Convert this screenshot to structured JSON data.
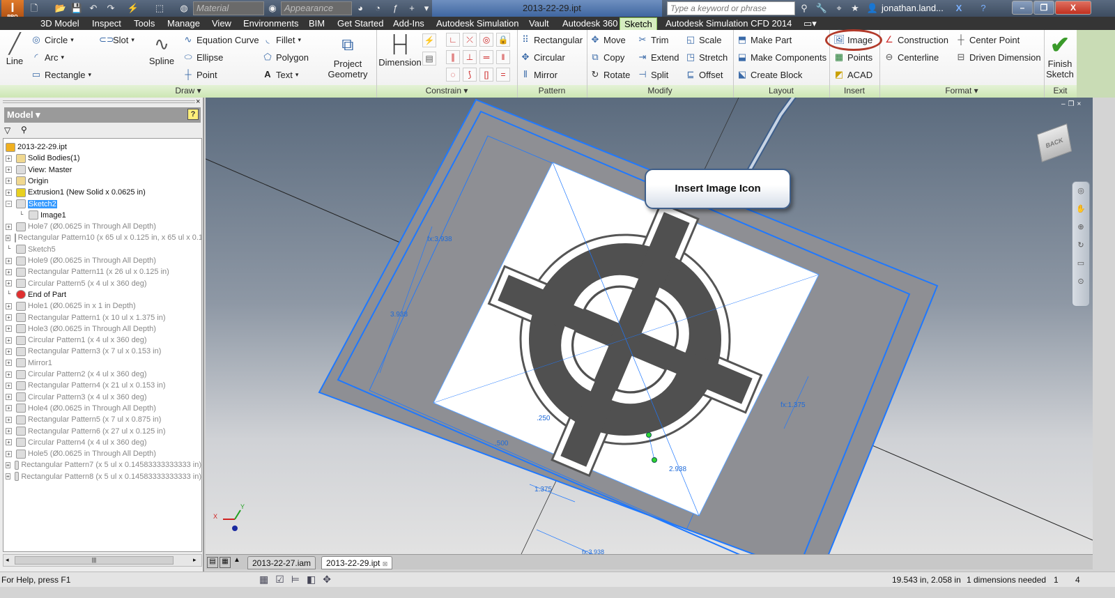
{
  "titlebar": {
    "app_icon_label": "PRO",
    "material": "Material",
    "appearance": "Appearance",
    "document_title": "2013-22-29.ipt",
    "search_placeholder": "Type a keyword or phrase",
    "user": "jonathan.land...",
    "minimize": "–",
    "restore": "❐",
    "close": "X"
  },
  "tabs": [
    "3D Model",
    "Inspect",
    "Tools",
    "Manage",
    "View",
    "Environments",
    "BIM",
    "Get Started",
    "Add-Ins",
    "Autodesk Simulation",
    "Vault",
    "Autodesk 360",
    "Sketch",
    "Autodesk Simulation CFD 2014"
  ],
  "active_tab": "Sketch",
  "ribbon": {
    "draw": {
      "line": "Line",
      "circle": "Circle",
      "arc": "Arc",
      "rectangle": "Rectangle",
      "slot": "Slot",
      "spline": "Spline",
      "equation_curve": "Equation Curve",
      "ellipse": "Ellipse",
      "point": "Point",
      "fillet": "Fillet",
      "polygon": "Polygon",
      "text": "Text",
      "project_geometry_1": "Project",
      "project_geometry_2": "Geometry",
      "label": "Draw ▾"
    },
    "constrain": {
      "dimension": "Dimension",
      "label": "Constrain ▾"
    },
    "pattern": {
      "rectangular": "Rectangular",
      "circular": "Circular",
      "mirror": "Mirror",
      "label": "Pattern"
    },
    "modify": {
      "move": "Move",
      "copy": "Copy",
      "rotate": "Rotate",
      "trim": "Trim",
      "extend": "Extend",
      "split": "Split",
      "scale": "Scale",
      "stretch": "Stretch",
      "offset": "Offset",
      "label": "Modify"
    },
    "layout": {
      "make_part": "Make Part",
      "make_components": "Make Components",
      "create_block": "Create Block",
      "label": "Layout"
    },
    "insert": {
      "image": "Image",
      "points": "Points",
      "acad": "ACAD",
      "label": "Insert"
    },
    "format": {
      "construction": "Construction",
      "centerline": "Centerline",
      "center_point": "Center Point",
      "driven_dimension": "Driven Dimension",
      "label": "Format ▾"
    },
    "exit": {
      "finish_1": "Finish",
      "finish_2": "Sketch",
      "label": "Exit"
    }
  },
  "browser": {
    "title": "Model ▾",
    "help": "?",
    "items": [
      {
        "label": "2013-22-29.ipt",
        "level": 0,
        "state": "normal",
        "expand": ""
      },
      {
        "label": "Solid Bodies(1)",
        "level": 1,
        "state": "normal",
        "expand": "+"
      },
      {
        "label": "View: Master",
        "level": 1,
        "state": "normal",
        "expand": "+"
      },
      {
        "label": "Origin",
        "level": 1,
        "state": "normal",
        "expand": "+"
      },
      {
        "label": "Extrusion1 (New Solid x 0.0625 in)",
        "level": 1,
        "state": "normal",
        "expand": "+"
      },
      {
        "label": "Sketch2",
        "level": 1,
        "state": "selected",
        "expand": "−"
      },
      {
        "label": "Image1",
        "level": 2,
        "state": "normal",
        "expand": ""
      },
      {
        "label": "Hole7 (Ø0.0625 in Through All Depth)",
        "level": 1,
        "state": "grey",
        "expand": "+"
      },
      {
        "label": "Rectangular Pattern10 (x 65 ul x 0.125 in, x 65 ul x 0.1",
        "level": 1,
        "state": "grey",
        "expand": "+"
      },
      {
        "label": "Sketch5",
        "level": 1,
        "state": "grey",
        "expand": ""
      },
      {
        "label": "Hole9 (Ø0.0625 in Through All Depth)",
        "level": 1,
        "state": "grey",
        "expand": "+"
      },
      {
        "label": "Rectangular Pattern11 (x 26 ul x 0.125 in)",
        "level": 1,
        "state": "grey",
        "expand": "+"
      },
      {
        "label": "Circular Pattern5 (x 4 ul x 360 deg)",
        "level": 1,
        "state": "grey",
        "expand": "+"
      },
      {
        "label": "End of Part",
        "level": 1,
        "state": "end",
        "expand": ""
      },
      {
        "label": "Hole1 (Ø0.0625 in x 1 in Depth)",
        "level": 1,
        "state": "grey",
        "expand": "+"
      },
      {
        "label": "Rectangular Pattern1 (x 10 ul x 1.375 in)",
        "level": 1,
        "state": "grey",
        "expand": "+"
      },
      {
        "label": "Hole3 (Ø0.0625 in Through All Depth)",
        "level": 1,
        "state": "grey",
        "expand": "+"
      },
      {
        "label": "Circular Pattern1 (x 4 ul x 360 deg)",
        "level": 1,
        "state": "grey",
        "expand": "+"
      },
      {
        "label": "Rectangular Pattern3 (x 7 ul x 0.153 in)",
        "level": 1,
        "state": "grey",
        "expand": "+"
      },
      {
        "label": "Mirror1",
        "level": 1,
        "state": "grey",
        "expand": "+"
      },
      {
        "label": "Circular Pattern2 (x 4 ul x 360 deg)",
        "level": 1,
        "state": "grey",
        "expand": "+"
      },
      {
        "label": "Rectangular Pattern4 (x 21 ul x 0.153 in)",
        "level": 1,
        "state": "grey",
        "expand": "+"
      },
      {
        "label": "Circular Pattern3 (x 4 ul x 360 deg)",
        "level": 1,
        "state": "grey",
        "expand": "+"
      },
      {
        "label": "Hole4 (Ø0.0625 in Through All Depth)",
        "level": 1,
        "state": "grey",
        "expand": "+"
      },
      {
        "label": "Rectangular Pattern5 (x 7 ul x 0.875 in)",
        "level": 1,
        "state": "grey",
        "expand": "+"
      },
      {
        "label": "Rectangular Pattern6 (x 27 ul x 0.125 in)",
        "level": 1,
        "state": "grey",
        "expand": "+"
      },
      {
        "label": "Circular Pattern4 (x 4 ul x 360 deg)",
        "level": 1,
        "state": "grey",
        "expand": "+"
      },
      {
        "label": "Hole5 (Ø0.0625 in Through All Depth)",
        "level": 1,
        "state": "grey",
        "expand": "+"
      },
      {
        "label": "Rectangular Pattern7 (x 5 ul x 0.14583333333333 in)",
        "level": 1,
        "state": "grey",
        "expand": "+"
      },
      {
        "label": "Rectangular Pattern8 (x 5 ul x 0.14583333333333 in)",
        "level": 1,
        "state": "grey",
        "expand": "+"
      }
    ]
  },
  "viewport": {
    "callout": "Insert Image Icon",
    "viewcube": "BACK",
    "dims": {
      "d1": "fx:3.938",
      "d2": "3.938",
      "d3": ".250",
      "d4": ".500",
      "d5": "1.375",
      "d6": "2.938",
      "d7": "fx:1.375",
      "d8": "fx:3.938"
    },
    "axis_x": "X",
    "axis_y": "Y"
  },
  "doc_tabs": [
    "2013-22-27.iam",
    "2013-22-29.ipt"
  ],
  "status": {
    "help": "For Help, press F1",
    "coords": "19.543 in, 2.058 in",
    "dims_needed": "1 dimensions needed",
    "n1": "1",
    "n2": "4"
  },
  "colors": {
    "accent": "#3399ff",
    "sketch_line": "#1e78ff",
    "callout_ring": "#c0392b",
    "panel_green": "#cde6b4"
  }
}
